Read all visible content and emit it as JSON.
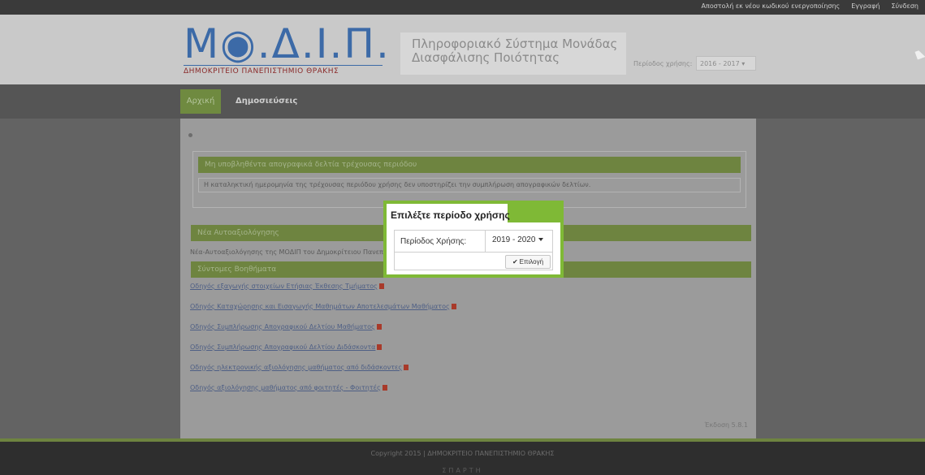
{
  "topbar": {
    "links": [
      "Αποστολή εκ νέου κωδικού ενεργοποίησης",
      "Εγγραφή",
      "Σύνδεση"
    ]
  },
  "logo": {
    "letters": "Μ◉.Δ.Ι.Π.",
    "subtitle": "ΔΗΜΟΚΡΙΤΕΙΟ ΠΑΝΕΠΙΣΤΗΜΙΟ ΘΡΑΚΗΣ"
  },
  "header": {
    "system_title_line1": "Πληροφοριακό Σύστημα Μονάδας",
    "system_title_line2": "Διασφάλισης Ποιότητας",
    "period_label": "Περίοδος χρήσης:",
    "period_value": "2016 - 2017 ▾"
  },
  "nav": {
    "home": "Αρχική",
    "publications": "Δημοσιεύσεις"
  },
  "content": {
    "warning_title": "Μη υποβληθέντα απογραφικά δελτία τρέχουσας περιόδου",
    "warning_text": "Η καταληκτική ημερομηνία της τρέχουσας περιόδου χρήσης δεν υποστηρίζει την συμπλήρωση απογραφικών δελτίων.",
    "announcements_title": "Νέα Αυτοαξιολόγησης",
    "announcements_text": "Νέα-Αυτοαξιολόγησης της ΜΟΔΙΠ του Δημοκρίτειου Πανεπιστημίου Θράκης",
    "guides_title": "Σύντομες Βοηθήματα",
    "guides": [
      "Οδηγός εξαγωγής στοιχείων Ετήσιας Έκθεσης Τμήματος",
      "Οδηγός Καταχώρησης και Εισαγωγής Μαθημάτων Αποτελεσμάτων Μαθήματος",
      "Οδηγός Συμπλήρωσης Απογραφικού Δελτίου Μαθήματος",
      "Οδηγός Συμπλήρωσης Απογραφικού Δελτίου Διδάσκοντα",
      "Οδηγός ηλεκτρονικής αξιολόγησης μαθήματος από διδάσκοντες",
      "Οδηγός αξιολόγησης μαθήματος από φοιτητές - Φοιτητές"
    ],
    "version": "Έκδοση 5.8.1"
  },
  "footer": {
    "copyright": "Copyright 2015 | ΔΗΜΟΚΡΙΤΕΙΟ ΠΑΝΕΠΙΣΤΗΜΙΟ ΘΡΑΚΗΣ",
    "logo_text": "ΣΠΑΡΤΗ"
  },
  "modal": {
    "title": "Επιλέξτε περίοδο χρήσης",
    "period_label": "Περίοδος Χρήσης:",
    "period_value": "2019 - 2020",
    "submit_label": "Επιλογή"
  },
  "colors": {
    "accent_green": "#7fb936",
    "dimmed_green": "#6e8440"
  }
}
